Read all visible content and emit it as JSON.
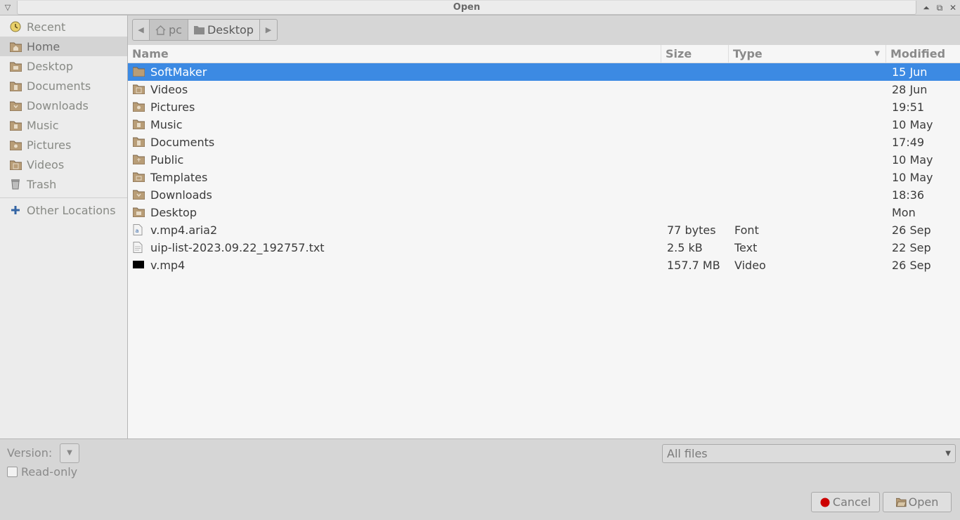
{
  "window": {
    "title": "Open"
  },
  "sidebar": {
    "items": [
      {
        "label": "Recent",
        "icon": "recent-icon"
      },
      {
        "label": "Home",
        "icon": "home-folder-icon"
      },
      {
        "label": "Desktop",
        "icon": "folder-icon"
      },
      {
        "label": "Documents",
        "icon": "folder-icon"
      },
      {
        "label": "Downloads",
        "icon": "folder-icon"
      },
      {
        "label": "Music",
        "icon": "folder-icon"
      },
      {
        "label": "Pictures",
        "icon": "folder-icon"
      },
      {
        "label": "Videos",
        "icon": "folder-icon"
      },
      {
        "label": "Trash",
        "icon": "trash-icon"
      }
    ],
    "other_locations": "Other Locations"
  },
  "pathbar": {
    "home": "pc",
    "current": "Desktop"
  },
  "columns": {
    "name": "Name",
    "size": "Size",
    "type": "Type",
    "modified": "Modified"
  },
  "files": [
    {
      "name": "SoftMaker",
      "size": "",
      "type": "",
      "modified": "15 Jun",
      "icon": "folder-icon"
    },
    {
      "name": "Videos",
      "size": "",
      "type": "",
      "modified": "28 Jun",
      "icon": "videos-folder-icon"
    },
    {
      "name": "Pictures",
      "size": "",
      "type": "",
      "modified": "19:51",
      "icon": "pictures-folder-icon"
    },
    {
      "name": "Music",
      "size": "",
      "type": "",
      "modified": "10 May",
      "icon": "music-folder-icon"
    },
    {
      "name": "Documents",
      "size": "",
      "type": "",
      "modified": "17:49",
      "icon": "documents-folder-icon"
    },
    {
      "name": "Public",
      "size": "",
      "type": "",
      "modified": "10 May",
      "icon": "public-folder-icon"
    },
    {
      "name": "Templates",
      "size": "",
      "type": "",
      "modified": "10 May",
      "icon": "templates-folder-icon"
    },
    {
      "name": "Downloads",
      "size": "",
      "type": "",
      "modified": "18:36",
      "icon": "downloads-folder-icon"
    },
    {
      "name": "Desktop",
      "size": "",
      "type": "",
      "modified": "Mon",
      "icon": "desktop-folder-icon"
    },
    {
      "name": "v.mp4.aria2",
      "size": "77 bytes",
      "type": "Font",
      "modified": "26 Sep",
      "icon": "font-file-icon"
    },
    {
      "name": "uip-list-2023.09.22_192757.txt",
      "size": "2.5  kB",
      "type": "Text",
      "modified": "22 Sep",
      "icon": "text-file-icon"
    },
    {
      "name": "v.mp4",
      "size": "157.7  MB",
      "type": "Video",
      "modified": "26 Sep",
      "icon": "video-file-icon"
    }
  ],
  "bottom": {
    "version_label": "Version:",
    "readonly_label": "Read-only",
    "filter_value": "All files",
    "cancel_label": "Cancel",
    "open_label": "Open"
  },
  "colors": {
    "selection": "#3c8ae3",
    "sidebar_bg": "#ececec",
    "list_bg": "#f6f6f6",
    "folder": "#b89d77"
  }
}
